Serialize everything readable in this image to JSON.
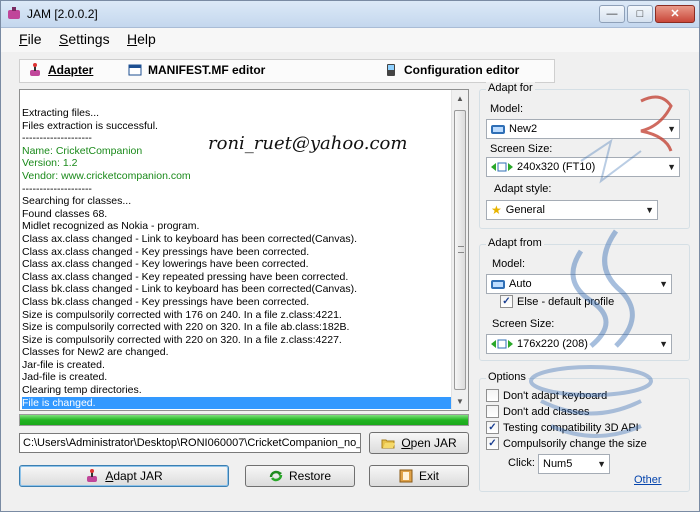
{
  "window": {
    "title": "JAM [2.0.0.2]"
  },
  "menu": [
    {
      "u": "F",
      "rest": "ile"
    },
    {
      "u": "S",
      "rest": "ettings"
    },
    {
      "u": "H",
      "rest": "elp"
    }
  ],
  "tabs": [
    {
      "label": "Adapter",
      "icon": "joystick-icon"
    },
    {
      "label": "MANIFEST.MF editor",
      "icon": "window-icon"
    },
    {
      "label": "Configuration editor",
      "icon": "phone-icon"
    }
  ],
  "log": [
    {
      "text": "Extracting files...",
      "style": "normal"
    },
    {
      "text": "Files extraction is successful.",
      "style": "normal"
    },
    {
      "text": "--------------------",
      "style": "normal"
    },
    {
      "text": "Name: CricketCompanion",
      "style": "green"
    },
    {
      "text": "Version: 1.2",
      "style": "green"
    },
    {
      "text": "Vendor: www.cricketcompanion.com",
      "style": "green"
    },
    {
      "text": "--------------------",
      "style": "normal"
    },
    {
      "text": "Searching for classes...",
      "style": "normal"
    },
    {
      "text": "Found classes 68.",
      "style": "normal"
    },
    {
      "text": "Midlet recognized as Nokia - program.",
      "style": "normal"
    },
    {
      "text": "Class ax.class changed - Link to keyboard has been corrected(Canvas).",
      "style": "normal"
    },
    {
      "text": "Class ax.class changed - Key pressings have been corrected.",
      "style": "normal"
    },
    {
      "text": "Class ax.class changed - Key lowerings have been corrected.",
      "style": "normal"
    },
    {
      "text": "Class ax.class changed - Key repeated pressing have been corrected.",
      "style": "normal"
    },
    {
      "text": "Class bk.class changed - Link to keyboard has been corrected(Canvas).",
      "style": "normal"
    },
    {
      "text": "Class bk.class changed - Key pressings have been corrected.",
      "style": "normal"
    },
    {
      "text": "Size is compulsorily corrected with 176 on 240. In a file z.class:4221.",
      "style": "normal"
    },
    {
      "text": "Size is compulsorily corrected with 220 on 320. In a file ab.class:182B.",
      "style": "normal"
    },
    {
      "text": "Size is compulsorily corrected with 220 on 320. In a file z.class:4227.",
      "style": "normal"
    },
    {
      "text": "Classes for New2 are changed.",
      "style": "normal"
    },
    {
      "text": "Jar-file is created.",
      "style": "normal"
    },
    {
      "text": "Jad-file is created.",
      "style": "normal"
    },
    {
      "text": "Clearing temp directories.",
      "style": "normal"
    },
    {
      "text": "File is changed.",
      "style": "selected"
    }
  ],
  "overlay_email": "roni_ruet@yahoo.com",
  "progress_percent": 100,
  "colors": {
    "progress": "#22b422",
    "selection": "#3399ff",
    "green_text": "#1a8a1a",
    "link": "#0645ad"
  },
  "path_value": "C:\\Users\\Administrator\\Desktop\\RONI060007\\CricketCompanion_no_tou",
  "buttons": {
    "open_jar": {
      "u": "O",
      "rest": "pen JAR"
    },
    "adapt_jar": {
      "u": "A",
      "rest": "dapt JAR"
    },
    "restore": "Restore",
    "exit": "Exit"
  },
  "adapt_for": {
    "title": "Adapt for",
    "model_label": "Model:",
    "model_value": "New2",
    "screen_label": "Screen Size:",
    "screen_value": "240x320 (FT10)",
    "style_label": "Adapt style:",
    "style_value": "General"
  },
  "adapt_from": {
    "title": "Adapt from",
    "model_label": "Model:",
    "model_value": "Auto",
    "else_label": "Else - default profile",
    "else_checked": true,
    "screen_label": "Screen Size:",
    "screen_value": "176x220 (208)"
  },
  "options": {
    "title": "Options",
    "items": [
      {
        "label": "Don't adapt keyboard",
        "checked": false
      },
      {
        "label": "Don't add classes",
        "checked": false
      },
      {
        "label": "Testing compatibility 3D API",
        "checked": true
      },
      {
        "label": "Compulsorily change the size",
        "checked": true
      }
    ],
    "click_label": "Click:",
    "click_value": "Num5",
    "other_link": "Other"
  }
}
